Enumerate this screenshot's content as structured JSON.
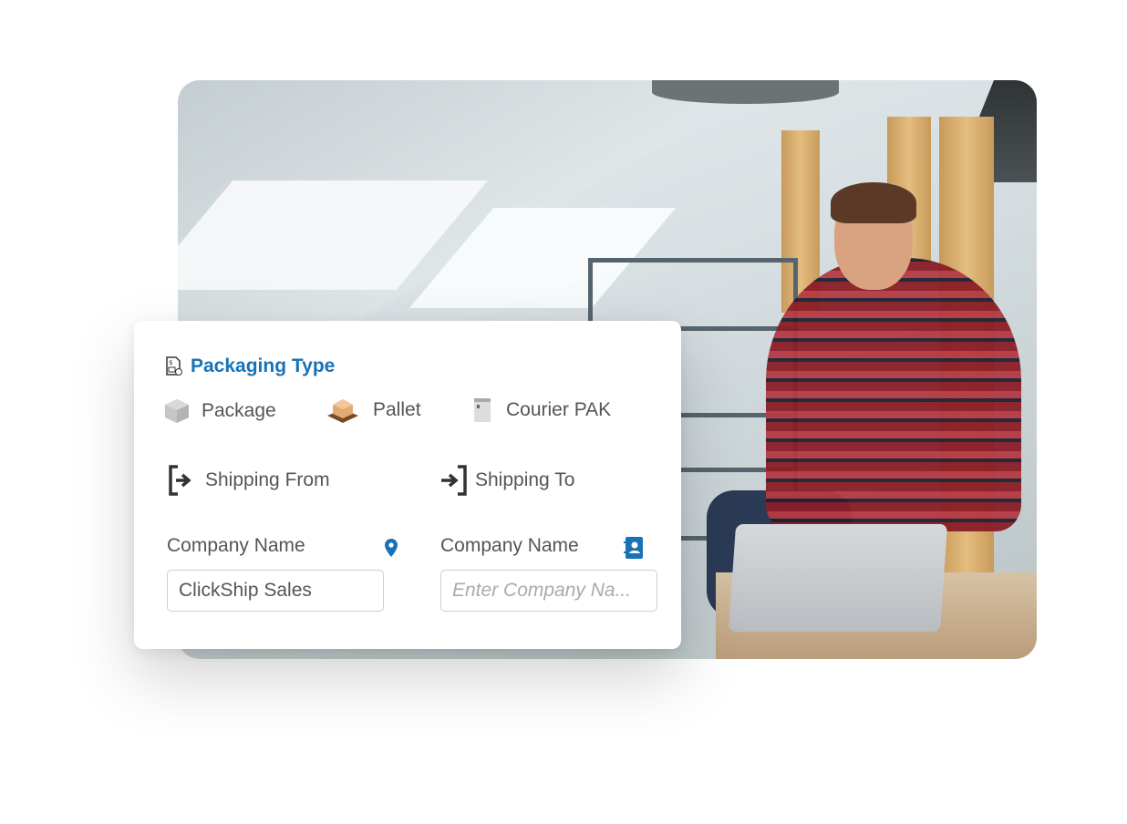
{
  "card": {
    "title": "Packaging Type",
    "packaging_options": [
      {
        "label": "Package",
        "icon": "box-icon"
      },
      {
        "label": "Pallet",
        "icon": "pallet-icon"
      },
      {
        "label": "Courier PAK",
        "icon": "courier-pak-icon"
      }
    ],
    "shipping_from": {
      "label": "Shipping From",
      "icon": "sign-out-icon"
    },
    "shipping_to": {
      "label": "Shipping To",
      "icon": "sign-in-icon"
    },
    "from_company": {
      "label": "Company Name",
      "value": "ClickShip Sales",
      "icon": "location-pin-icon"
    },
    "to_company": {
      "label": "Company Name",
      "placeholder": "Enter Company Na...",
      "icon": "address-book-icon"
    },
    "accent_color": "#1772b6"
  }
}
